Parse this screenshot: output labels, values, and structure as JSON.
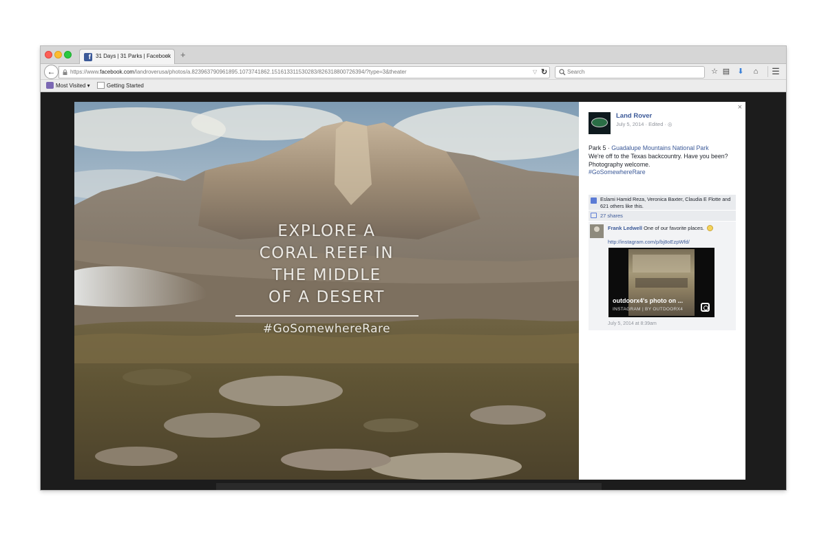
{
  "browser": {
    "tab_title": "31 Days | 31 Parks | Facebook",
    "tab_close": "×",
    "new_tab": "+",
    "url_prefix": "https://www.",
    "url_domain": "facebook.com",
    "url_rest": "/landroverusa/photos/a.823963790961895.1073741862.151613311530283/826318800726394/?type=3&theater",
    "search_placeholder": "Search",
    "bookmarks": [
      "Most Visited",
      "Getting Started"
    ]
  },
  "overlay": {
    "headline_lines": [
      "EXPLORE A",
      "CORAL REEF IN",
      "THE MIDDLE",
      "OF A DESERT"
    ],
    "hashtag": "#GoSomewhereRare"
  },
  "post": {
    "close": "×",
    "page_name": "Land Rover",
    "meta": "July 5, 2014 · Edited · ",
    "park_label": "Park 5",
    "separator": " · ",
    "location": "Guadalupe Mountains National Park",
    "body": "We're off to the Texas backcountry. Have you been? Photography welcome.",
    "hashtag": "#GoSomewhereRare",
    "likes": "Eslami Hamid Reza, Veronica Baxter, Claudia E Flotte and 621 others like this.",
    "shares": "27 shares",
    "comment": {
      "author": "Frank Ledwell",
      "text": " One of our favorite places. ",
      "link": "http://instagram.com/p/bj8oEzpWfd/",
      "card_title": "outdoorx4's photo on ...",
      "card_sub": "INSTAGRAM  |  BY OUTDOORX4",
      "time": "July 5, 2014 at 8:39am"
    }
  },
  "colors": {
    "facebook_blue": "#3b5998",
    "panel_bg": "#ffffff",
    "comment_bg": "#f2f3f5"
  }
}
